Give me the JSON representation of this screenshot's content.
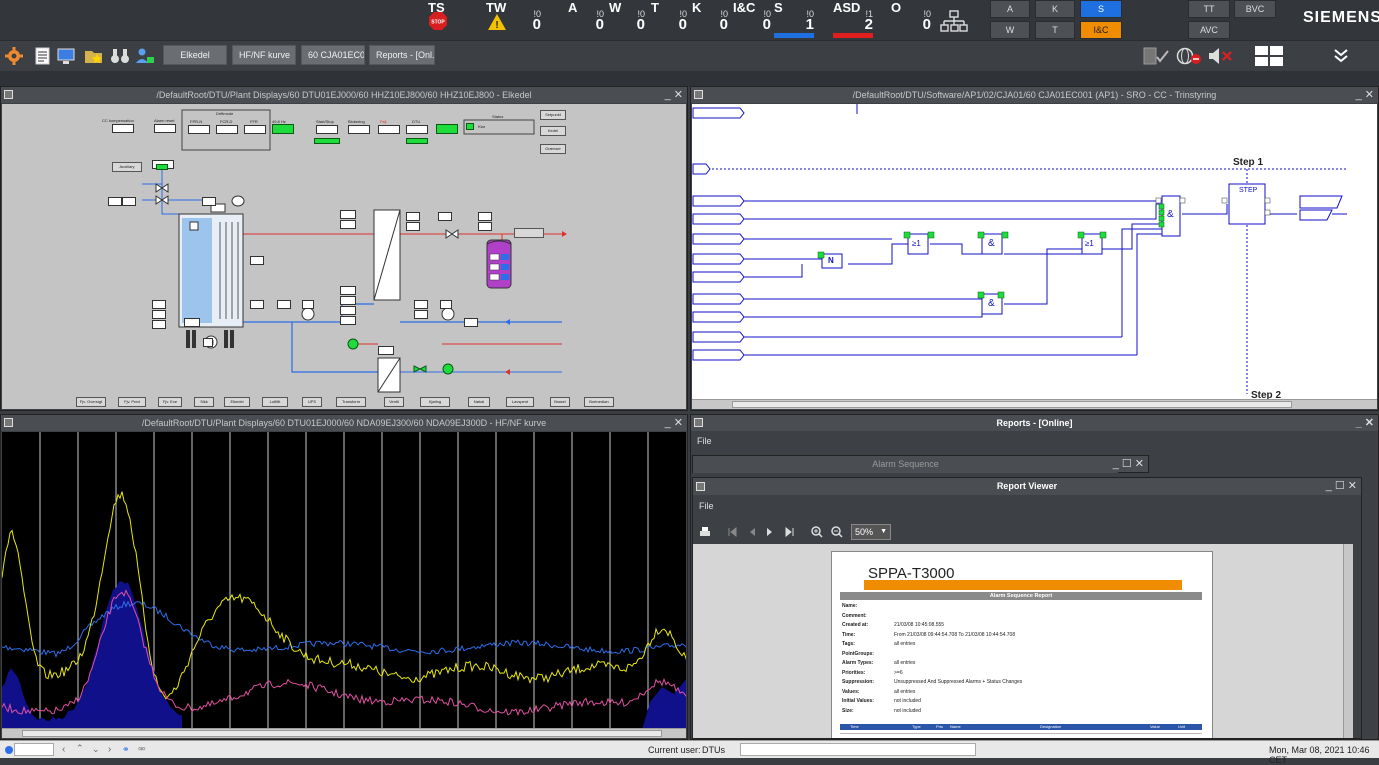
{
  "alarm_bar": {
    "categories": [
      {
        "label": "TS",
        "small": "",
        "count": ""
      },
      {
        "label": "TW",
        "small": "!0",
        "count": "0"
      },
      {
        "label": "A",
        "small": "!0",
        "count": "0"
      },
      {
        "label": "W",
        "small": "!0",
        "count": "0"
      },
      {
        "label": "T",
        "small": "!0",
        "count": "0"
      },
      {
        "label": "K",
        "small": "!0",
        "count": "0"
      },
      {
        "label": "I&C",
        "small": "!0",
        "count": "0"
      },
      {
        "label": "S",
        "small": "!0",
        "count": "1",
        "bar_color": "#1e6fe0"
      },
      {
        "label": "ASD",
        "small": "!1",
        "count": "2",
        "bar_color": "#e01e1e"
      },
      {
        "label": "O",
        "small": "!0",
        "count": "0"
      }
    ],
    "filter_buttons": [
      "A",
      "K",
      "S",
      "W",
      "T",
      "I&C",
      "TT",
      "BVC",
      "AVC"
    ],
    "brand": "SIEMENS"
  },
  "toolbar": {
    "tabs": [
      "Elkedel",
      "HF/NF kurve",
      "60 CJA01EC001",
      "Reports - [Onl..."
    ]
  },
  "panels": {
    "elkedel": {
      "title": "/DefaultRoot/DTU/Plant Displays/60 DTU01EJ000/60 HHZ10EJ800/60 HHZ10EJ800 - Elkedel",
      "labels": {
        "cc_compensation": "CC kompensation",
        "alarm_reset": "Alarm reset",
        "driftmode": "Driftmode",
        "fpr_n": "FPR-N",
        "fcr_d": "FCR-D",
        "ffr": "FFR",
        "freq": "49.8 Hz",
        "start_stop": "Start/Stop",
        "blokering": "Blokering",
        "fejl": "Fejl",
        "dtu": "DTU",
        "status": "Status",
        "klar": "Klar",
        "setpunkt": "Setpunkt",
        "kedel": "Kedel",
        "grenser": "Grænser",
        "aux": "Auxiliary"
      },
      "bottom_buttons": [
        "Fjv. Oversigt",
        "Fjv. Pred",
        "Fjv. Exe",
        "Sikk",
        "Elkedel",
        "Luftfilt",
        "UPS",
        "Transform",
        "Ventil",
        "Kjøling",
        "Nøkal",
        "Lavspent",
        "Brøsel",
        "Bortnedløn"
      ]
    },
    "cja01": {
      "title": "/DefaultRoot/DTU/Software/AP1/02/CJA01/60 CJA01EC001 (AP1) - SRO - CC - Trinstyring",
      "step1": "Step 1",
      "step2": "Step 2",
      "step_block": "STEP",
      "and_symbol": "&",
      "or_symbol": "≥1",
      "not_symbol": "N"
    },
    "hfnf": {
      "title": "/DefaultRoot/DTU/Plant Displays/60 DTU01EJ000/60 NDA09EJ300/60 NDA09EJ300D - HF/NF kurve"
    },
    "reports": {
      "title": "Reports - [Online]",
      "menu_file": "File",
      "alarm_sequence_title": "Alarm Sequence",
      "viewer_title": "Report Viewer",
      "viewer_menu_file": "File",
      "zoom": "50%",
      "report": {
        "brand": "SPPA-T3000",
        "heading": "Alarm Sequence Report",
        "fields": [
          {
            "label": "Name:",
            "value": ""
          },
          {
            "label": "Comment:",
            "value": ""
          },
          {
            "label": "Created at:",
            "value": "21/03/08 10:45:08.555"
          },
          {
            "label": "Time:",
            "value": "From          21/03/08 09:44:54.708          To          21/03/08 10:44:54.708"
          },
          {
            "label": "Tags:",
            "value": "all entries"
          },
          {
            "label": "PointGroups:",
            "value": ""
          },
          {
            "label": "Alarm Types:",
            "value": "all entries"
          },
          {
            "label": "Priorities:",
            "value": ">=6"
          },
          {
            "label": "Suppression:",
            "value": "Unsuppressed And Suppressed Alarms + Status Changes"
          },
          {
            "label": "Values:",
            "value": "all entries"
          },
          {
            "label": "Initial Values:",
            "value": "not included"
          },
          {
            "label": "Size:",
            "value": "not included"
          }
        ],
        "table_headers": [
          "Time",
          "Type",
          "Prio",
          "Name",
          "Designation",
          "Value",
          "Unit"
        ]
      }
    }
  },
  "status_bar": {
    "current_user_label": "Current user:",
    "current_user": "DTUs",
    "datetime": "Mon, Mar 08, 2021 10:46 CET"
  },
  "colors": {
    "accent_blue": "#1e6fe0",
    "accent_orange": "#f08c00",
    "alarm_red": "#e01e1e",
    "ok_green": "#1edc3c",
    "trend_yellow": "#e8e800",
    "trend_pink": "#e050a0",
    "trend_blue": "#2c6ee8"
  }
}
